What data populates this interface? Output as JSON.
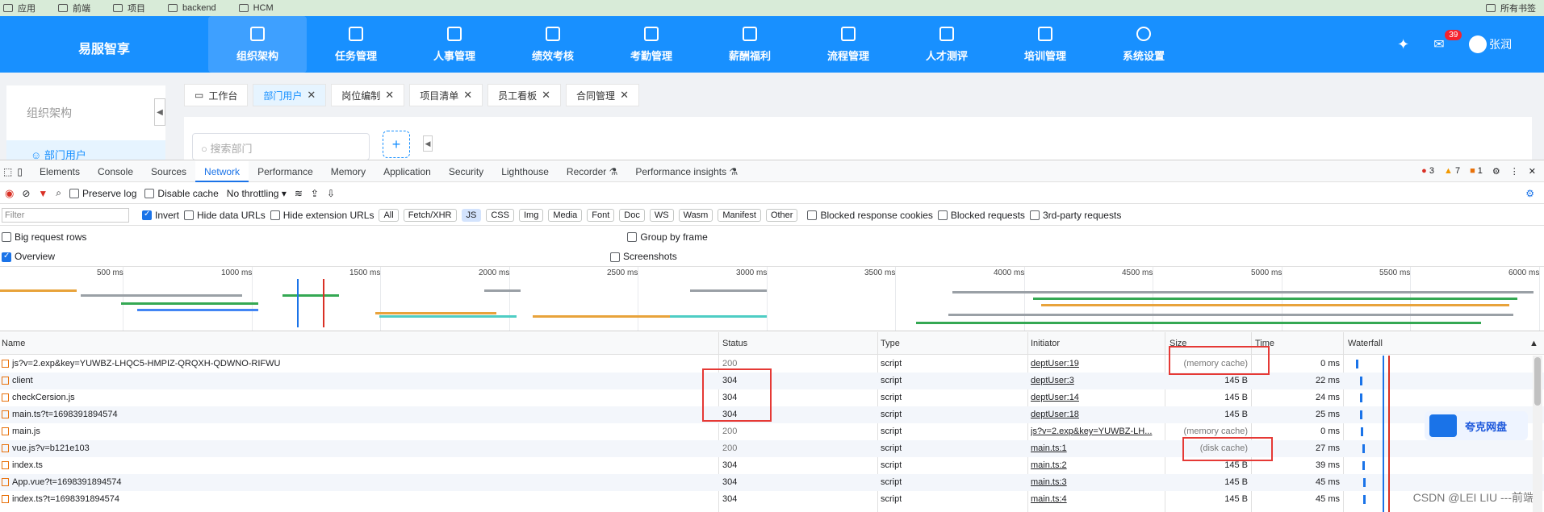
{
  "bookmarks": [
    "应用",
    "前端",
    "项目",
    "backend",
    "HCM"
  ],
  "bookmarks_right": "所有书签",
  "app": {
    "brand": "易服智享",
    "nav": [
      "组织架构",
      "任务管理",
      "人事管理",
      "绩效考核",
      "考勤管理",
      "薪酬福利",
      "流程管理",
      "人才测评",
      "培训管理",
      "系统设置"
    ],
    "badge": "39",
    "user": "张润"
  },
  "page": {
    "left_title": "组织架构",
    "left_item": "部门用户",
    "tabs": [
      "工作台",
      "部门用户",
      "岗位编制",
      "项目清单",
      "员工看板",
      "合同管理"
    ],
    "search_placeholder": "搜索部门",
    "plus": "+"
  },
  "devtools": {
    "tabs": [
      "Elements",
      "Console",
      "Sources",
      "Network",
      "Performance",
      "Memory",
      "Application",
      "Security",
      "Lighthouse",
      "Recorder",
      "Performance insights"
    ],
    "errors": "3",
    "warnings": "7",
    "issues": "1",
    "toolbar": {
      "preserve_log": "Preserve log",
      "disable_cache": "Disable cache",
      "throttling": "No throttling"
    },
    "filter_placeholder": "Filter",
    "invert": "Invert",
    "hide_data_urls": "Hide data URLs",
    "hide_ext_urls": "Hide extension URLs",
    "chips": [
      "All",
      "Fetch/XHR",
      "JS",
      "CSS",
      "Img",
      "Media",
      "Font",
      "Doc",
      "WS",
      "Wasm",
      "Manifest",
      "Other"
    ],
    "blocked_cookies": "Blocked response cookies",
    "blocked_requests": "Blocked requests",
    "third_party": "3rd-party requests",
    "big_rows": "Big request rows",
    "group_by_frame": "Group by frame",
    "overview": "Overview",
    "screenshots": "Screenshots",
    "timeline_ticks": [
      "500 ms",
      "1000 ms",
      "1500 ms",
      "2000 ms",
      "2500 ms",
      "3000 ms",
      "3500 ms",
      "4000 ms",
      "4500 ms",
      "5000 ms",
      "5500 ms",
      "6000 ms"
    ],
    "columns": [
      "Name",
      "Status",
      "Type",
      "Initiator",
      "Size",
      "Time",
      "Waterfall"
    ],
    "rows": [
      {
        "name": "js?v=2.exp&key=YUWBZ-LHQC5-HMPIZ-QRQXH-QDWNO-RIFWU",
        "status": "200",
        "type": "script",
        "initiator": "deptUser:19",
        "size": "(memory cache)",
        "time": "0 ms"
      },
      {
        "name": "client",
        "status": "304",
        "type": "script",
        "initiator": "deptUser:3",
        "size": "145 B",
        "time": "22 ms"
      },
      {
        "name": "checkCersion.js",
        "status": "304",
        "type": "script",
        "initiator": "deptUser:14",
        "size": "145 B",
        "time": "24 ms"
      },
      {
        "name": "main.ts?t=1698391894574",
        "status": "304",
        "type": "script",
        "initiator": "deptUser:18",
        "size": "145 B",
        "time": "25 ms"
      },
      {
        "name": "main.js",
        "status": "200",
        "type": "script",
        "initiator": "js?v=2.exp&key=YUWBZ-LH...",
        "size": "(memory cache)",
        "time": "0 ms"
      },
      {
        "name": "vue.js?v=b121e103",
        "status": "200",
        "type": "script",
        "initiator": "main.ts:1",
        "size": "(disk cache)",
        "time": "27 ms"
      },
      {
        "name": "index.ts",
        "status": "304",
        "type": "script",
        "initiator": "main.ts:2",
        "size": "145 B",
        "time": "39 ms"
      },
      {
        "name": "App.vue?t=1698391894574",
        "status": "304",
        "type": "script",
        "initiator": "main.ts:3",
        "size": "145 B",
        "time": "45 ms"
      },
      {
        "name": "index.ts?t=1698391894574",
        "status": "304",
        "type": "script",
        "initiator": "main.ts:4",
        "size": "145 B",
        "time": "45 ms"
      }
    ]
  },
  "overlay": {
    "yunpan": "夸克网盘",
    "watermark": "CSDN @LEI LIU ---前端"
  },
  "colors": {
    "brand": "#1890ff",
    "accent": "#1a73e8",
    "highlight": "#e53935"
  }
}
